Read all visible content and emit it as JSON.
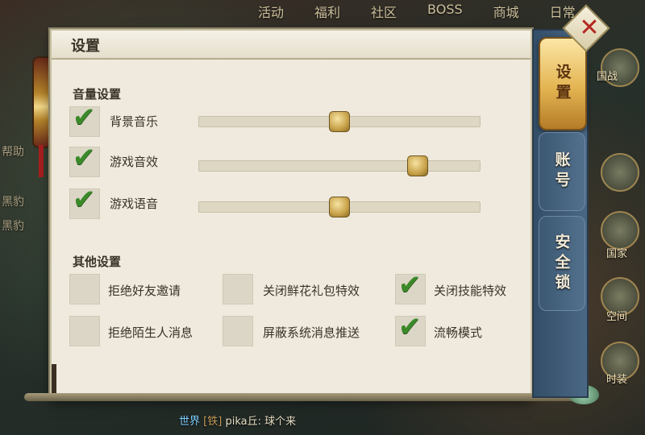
{
  "top_menu": [
    "活动",
    "福利",
    "社区",
    "BOSS",
    "商城",
    "日常"
  ],
  "panel": {
    "title": "设置",
    "volume_section": "音量设置",
    "volume_items": [
      {
        "label": "背景音乐",
        "checked": true,
        "level": 0.5
      },
      {
        "label": "游戏音效",
        "checked": true,
        "level": 0.78
      },
      {
        "label": "游戏语音",
        "checked": true,
        "level": 0.5
      }
    ],
    "other_section": "其他设置",
    "other_options": [
      {
        "label": "拒绝好友邀请",
        "checked": false
      },
      {
        "label": "关闭鲜花礼包特效",
        "checked": false
      },
      {
        "label": "关闭技能特效",
        "checked": true
      },
      {
        "label": "拒绝陌生人消息",
        "checked": false
      },
      {
        "label": "屏蔽系统消息推送",
        "checked": false
      },
      {
        "label": "流畅模式",
        "checked": true
      }
    ]
  },
  "tabs": [
    {
      "label": "设置",
      "active": true
    },
    {
      "label": "账号",
      "active": false
    },
    {
      "label": "安全锁",
      "active": false
    }
  ],
  "close_glyph": "✕",
  "check_glyph": "✔",
  "background": {
    "left_texts": [
      "帮助",
      "黑豹",
      "黑豹"
    ],
    "right_labels": [
      "国战",
      "国家",
      "空间",
      "时装"
    ]
  },
  "chat": {
    "channel": "世界",
    "badge": "[铁]",
    "text": "pika丘: 球个来"
  }
}
